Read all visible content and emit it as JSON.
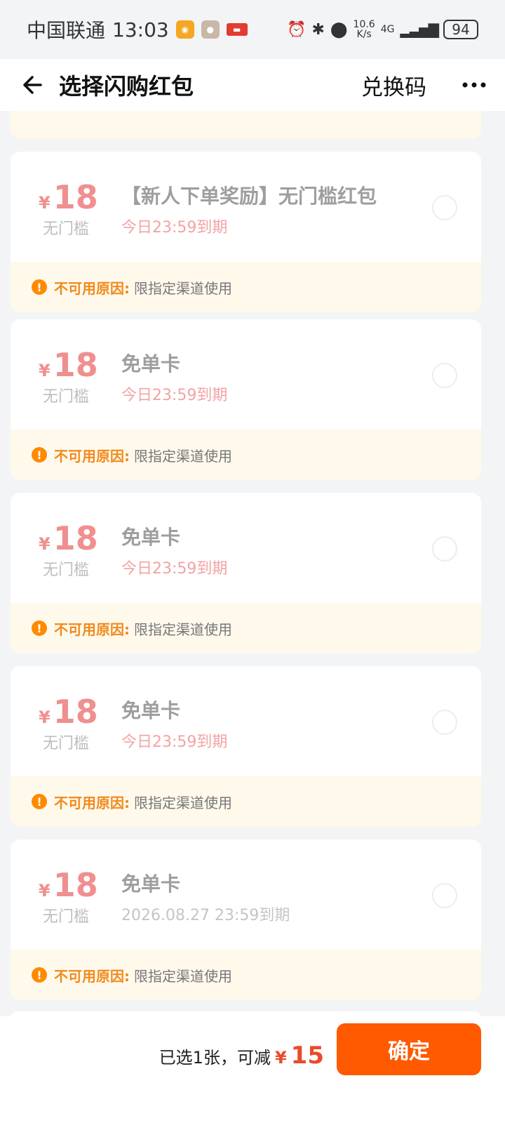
{
  "status_bar": {
    "carrier": "中国联通",
    "time": "13:03",
    "net_speed_top": "10.6",
    "net_speed_bottom": "K/s",
    "network": "4G",
    "battery": "94"
  },
  "header": {
    "title": "选择闪购红包",
    "redeem_label": "兑换码"
  },
  "coupons": [
    {
      "currency": "¥",
      "amount": "18",
      "threshold": "无门槛",
      "name": "【新人下单奖励】无门槛红包",
      "expiry": "今日23:59到期",
      "reason_label": "不可用原因:",
      "reason_text": "限指定渠道使用"
    },
    {
      "currency": "¥",
      "amount": "18",
      "threshold": "无门槛",
      "name": "免单卡",
      "expiry": "今日23:59到期",
      "reason_label": "不可用原因:",
      "reason_text": "限指定渠道使用"
    },
    {
      "currency": "¥",
      "amount": "18",
      "threshold": "无门槛",
      "name": "免单卡",
      "expiry": "今日23:59到期",
      "reason_label": "不可用原因:",
      "reason_text": "限指定渠道使用"
    },
    {
      "currency": "¥",
      "amount": "18",
      "threshold": "无门槛",
      "name": "免单卡",
      "expiry": "今日23:59到期",
      "reason_label": "不可用原因:",
      "reason_text": "限指定渠道使用"
    },
    {
      "currency": "¥",
      "amount": "18",
      "threshold": "无门槛",
      "name": "免单卡",
      "expiry": "2026.08.27 23:59到期",
      "reason_label": "不可用原因:",
      "reason_text": "限指定渠道使用"
    }
  ],
  "bottom": {
    "summary_text": "已选1张，可减",
    "currency": "¥",
    "discount": "15",
    "confirm_label": "确定"
  },
  "colors": {
    "accent": "#ff5a00",
    "price": "#f08f8f",
    "reason_bg": "#fff9ec"
  }
}
